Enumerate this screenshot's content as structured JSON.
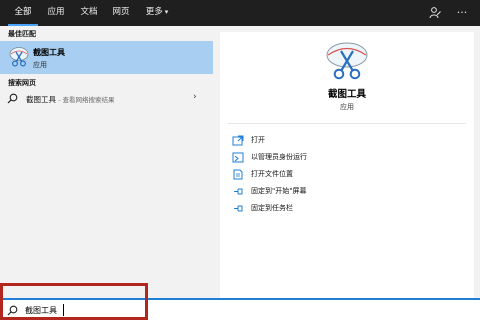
{
  "tabs": [
    {
      "label": "全部",
      "active": true
    },
    {
      "label": "应用",
      "active": false
    },
    {
      "label": "文档",
      "active": false
    },
    {
      "label": "网页",
      "active": false
    },
    {
      "label": "更多",
      "active": false
    }
  ],
  "tab_more_arrow": "▾",
  "top_icons": {
    "feedback_icon": "feedback-icon",
    "more_icon": "···"
  },
  "left": {
    "best_match_label": "最佳匹配",
    "best_match": {
      "title": "截图工具",
      "subtitle": "应用",
      "icon": "snipping-tool-icon"
    },
    "web_label": "搜索网页",
    "web_result": {
      "main": "截图工具",
      "suffix": " - 查看网络搜索结果",
      "chevron": "›"
    }
  },
  "right": {
    "title": "截图工具",
    "subtitle": "应用",
    "actions": [
      {
        "label": "打开",
        "icon": "open-icon"
      },
      {
        "label": "以管理员身份运行",
        "icon": "run-as-admin-icon"
      },
      {
        "label": "打开文件位置",
        "icon": "file-location-icon"
      },
      {
        "label": "固定到\"开始\"屏幕",
        "icon": "pin-start-icon"
      },
      {
        "label": "固定到任务栏",
        "icon": "pin-taskbar-icon"
      }
    ]
  },
  "search": {
    "value": "截图工具",
    "icon": "search-icon"
  },
  "colors": {
    "accent": "#1f7fd6",
    "selected_row": "#a8cff2",
    "highlight_box": "#b3261e",
    "topbar": "#1f1f1f"
  }
}
